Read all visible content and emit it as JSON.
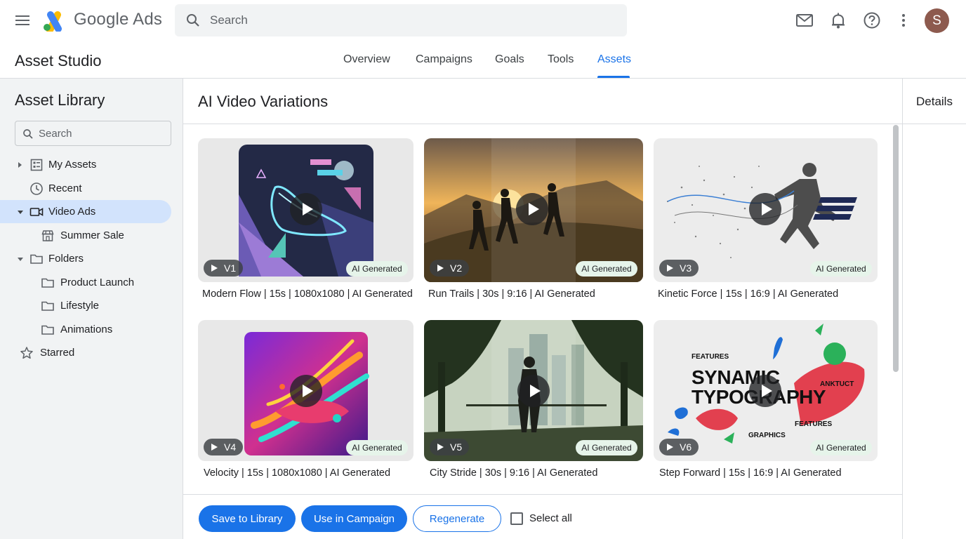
{
  "app": {
    "brand": "Google Ads",
    "section": "Asset Studio"
  },
  "search": {
    "placeholder": "Search"
  },
  "user": {
    "avatar_initial": "S"
  },
  "colors": {
    "accent": "#1a73e8",
    "selected_bg": "#d2e3fc",
    "ai_badge_bg": "#e6f4ea",
    "avatar_bg": "#8d5a4e"
  },
  "icons": [
    "menu-icon",
    "google-ads-logo",
    "search-icon",
    "mail-icon",
    "bell-icon",
    "help-icon",
    "more-vert-icon"
  ],
  "tabs": [
    {
      "label": "Overview",
      "active": false
    },
    {
      "label": "Campaigns",
      "active": false
    },
    {
      "label": "Goals",
      "active": false
    },
    {
      "label": "Tools",
      "active": false
    },
    {
      "label": "Assets",
      "active": true
    }
  ],
  "sidebar": {
    "title": "Asset Library",
    "search_placeholder": "Search",
    "items": [
      {
        "label": "My Assets",
        "icon": "grid-icon",
        "expandable": true,
        "expanded": false
      },
      {
        "label": "Recent",
        "icon": "clock-icon"
      },
      {
        "label": "Video Ads",
        "icon": "video-icon",
        "expandable": true,
        "expanded": true,
        "selected": true
      },
      {
        "label": "Summer Sale",
        "icon": "store-icon",
        "level": 2
      },
      {
        "label": "Folders",
        "icon": "folder-icon",
        "expandable": true,
        "expanded": true
      },
      {
        "label": "Product Launch",
        "icon": "folder-icon",
        "level": 2
      },
      {
        "label": "Lifestyle",
        "icon": "folder-icon",
        "level": 2
      },
      {
        "label": "Animations",
        "icon": "folder-icon",
        "level": 2
      },
      {
        "label": "Starred",
        "icon": "star-icon"
      }
    ]
  },
  "main": {
    "title": "AI Video Variations",
    "videos": [
      {
        "version": "V1",
        "badge": "AI Generated",
        "caption": "Modern Flow | 15s | 1080x1080 | AI Generated"
      },
      {
        "version": "V2",
        "badge": "AI Generated",
        "caption": "Run Trails | 30s | 9:16 | AI Generated"
      },
      {
        "version": "V3",
        "badge": "AI Generated",
        "caption": "Kinetic Force | 15s | 16:9 | AI Generated"
      },
      {
        "version": "V4",
        "badge": "AI Generated",
        "caption": "Velocity | 15s | 1080x1080 | AI Generated"
      },
      {
        "version": "V5",
        "badge": "AI Generated",
        "caption": "City Stride | 30s | 9:16 | AI Generated"
      },
      {
        "version": "V6",
        "badge": "AI Generated",
        "caption": "Step Forward | 15s | 16:9 | AI Generated"
      }
    ],
    "thumb_text": {
      "v6": {
        "features_1": "FEATURES",
        "headline_1": "SYNAMIC",
        "headline_2": "TYPOGRAPHY",
        "tag": "ANKTUCT",
        "features_2": "FEATURES",
        "graphics": "GRAPHICS"
      }
    }
  },
  "actions": {
    "save": "Save to Library",
    "use": "Use in Campaign",
    "regenerate": "Regenerate",
    "select_all": "Select all"
  },
  "details": {
    "title": "Details"
  }
}
